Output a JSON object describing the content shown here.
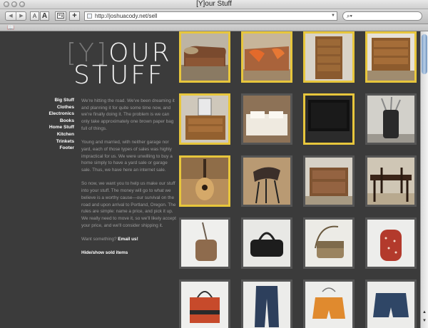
{
  "window": {
    "title": "[Y]our Stuff"
  },
  "toolbar": {
    "back_label": "◀",
    "forward_label": "▶",
    "text_smaller_label": "A",
    "text_bigger_label": "A",
    "add_bookmark_label": "+",
    "url": "http://joshuacody.net/sell",
    "search_value": "",
    "bookmarks_icon_label": "📖"
  },
  "site": {
    "logo_line1_open": "[",
    "logo_line1_y": "Y",
    "logo_line1_close": "]",
    "logo_line1_rest": "OUR",
    "logo_line2": "STUFF"
  },
  "nav": [
    "Big Stuff",
    "Clothes",
    "Electronics",
    "Books",
    "Home Stuff",
    "Kitchen",
    "Trinkets",
    "Footer"
  ],
  "intro": {
    "p1": "We're hitting the road. We've been dreaming it and planning it for quite some time now, and we're finally doing it. The problem is we can only take approximately one brown paper bag full of things.",
    "p2": "Young and married, with neither garage nor yard, each of those types of sales was highly impractical for us. We were unwilling to buy a home simply to have a yard sale or garage sale. Thus, we have here an internet sale.",
    "p3": "So now, we want you to help us make our stuff into your stuff. The money will go to what we believe is a worthy cause—our survival on the road and upon arrival to Portland, Oregon. The rules are simple: name a price, and pick it up. We really need to move it, so we'll likely accept your price, and we'll consider shipping it.",
    "want_prefix": "Want something?",
    "email_link": "Email us!",
    "toggle_sold": "Hide/show sold items"
  },
  "items": [
    {
      "name": "brown couch",
      "sold": true
    },
    {
      "name": "couch with pillows",
      "sold": true
    },
    {
      "name": "tall wooden dresser",
      "sold": true
    },
    {
      "name": "wooden dresser",
      "sold": true
    },
    {
      "name": "low dresser",
      "sold": true
    },
    {
      "name": "bed",
      "sold": false
    },
    {
      "name": "flat screen tv",
      "sold": true
    },
    {
      "name": "golf bag",
      "sold": false
    },
    {
      "name": "acoustic guitar",
      "sold": true
    },
    {
      "name": "bar stool",
      "sold": false
    },
    {
      "name": "wooden cabinet",
      "sold": false
    },
    {
      "name": "dining table",
      "sold": false
    },
    {
      "name": "brown shoulder bag",
      "sold": false
    },
    {
      "name": "black handbag",
      "sold": false
    },
    {
      "name": "messenger bag",
      "sold": false
    },
    {
      "name": "red polka dot backpack",
      "sold": false
    },
    {
      "name": "tote bag",
      "sold": false
    },
    {
      "name": "jeans",
      "sold": false
    },
    {
      "name": "orange shorts",
      "sold": false
    },
    {
      "name": "denim shorts",
      "sold": false
    }
  ],
  "colors": {
    "sold_border": "#e7c63c",
    "tile_border": "#555555",
    "page_bg": "#3b3b3b"
  }
}
